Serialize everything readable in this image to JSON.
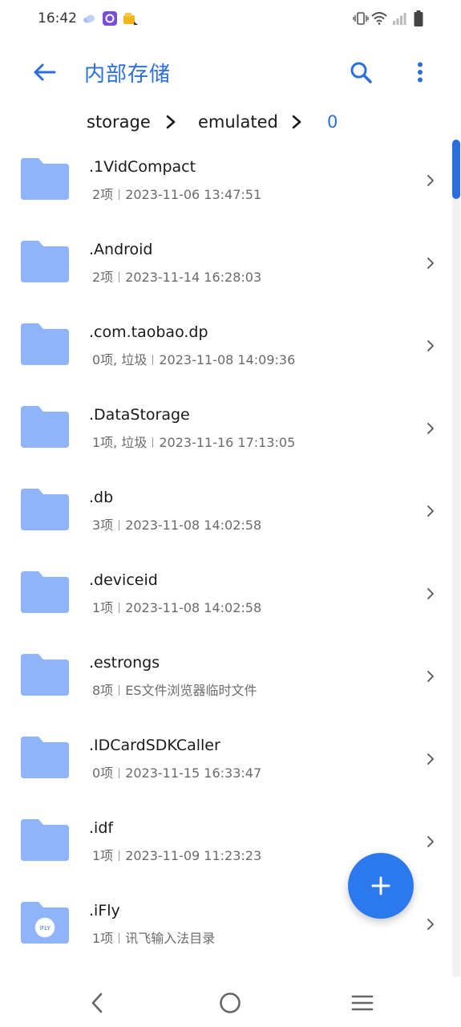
{
  "status_bar": {
    "time": "16:42",
    "icons": [
      "weather-cloud-icon",
      "app-notification-icon",
      "package-notification-icon",
      "vibrate-icon",
      "wifi-icon",
      "signal-icon",
      "battery-icon"
    ]
  },
  "app_bar": {
    "title": "内部存储",
    "back_icon": "arrow-left-icon",
    "search_icon": "search-icon",
    "more_icon": "more-vertical-icon"
  },
  "breadcrumb": {
    "items": [
      "storage",
      "emulated",
      "0"
    ]
  },
  "files": [
    {
      "name": ".1VidCompact",
      "count": "2项",
      "detail": "2023-11-06 13:47:51",
      "icon": "folder-icon"
    },
    {
      "name": ".Android",
      "count": "2项",
      "detail": "2023-11-14 16:28:03",
      "icon": "folder-icon"
    },
    {
      "name": ".com.taobao.dp",
      "count": "0项, 垃圾",
      "detail": "2023-11-08 14:09:36",
      "icon": "folder-icon"
    },
    {
      "name": ".DataStorage",
      "count": "1项, 垃圾",
      "detail": "2023-11-16 17:13:05",
      "icon": "folder-icon"
    },
    {
      "name": ".db",
      "count": "3项",
      "detail": "2023-11-08 14:02:58",
      "icon": "folder-icon"
    },
    {
      "name": ".deviceid",
      "count": "1项",
      "detail": "2023-11-08 14:02:58",
      "icon": "folder-icon"
    },
    {
      "name": ".estrongs",
      "count": "8项",
      "detail": "ES文件浏览器临时文件",
      "icon": "folder-icon"
    },
    {
      "name": ".IDCardSDKCaller",
      "count": "0项",
      "detail": "2023-11-15 16:33:47",
      "icon": "folder-icon"
    },
    {
      "name": ".idf",
      "count": "1项",
      "detail": "2023-11-09 11:23:23",
      "icon": "folder-icon"
    },
    {
      "name": ".iFly",
      "count": "1项",
      "detail": "讯飞输入法目录",
      "icon": "ifly-folder-icon",
      "badge": "iFLY"
    }
  ],
  "fab": {
    "icon": "plus-icon"
  },
  "nav_bar": {
    "icons": [
      "nav-back-icon",
      "nav-home-icon",
      "nav-recents-icon"
    ]
  },
  "colors": {
    "accent": "#2a6fdb",
    "folder": "#8fb4f9",
    "fab": "#2c79ee"
  }
}
